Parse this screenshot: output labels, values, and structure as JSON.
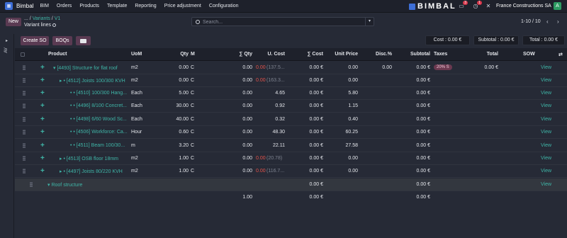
{
  "app": {
    "name": "Bimbal",
    "menu": [
      "BIM",
      "Orders",
      "Products",
      "Template",
      "Reporting",
      "Price adjustment",
      "Configuration"
    ],
    "brand": "BIMBAL",
    "chat_count": "3",
    "activity_count": "1",
    "company": "France Constructions SA",
    "user_initial": "A"
  },
  "control": {
    "new_label": "New",
    "breadcrumb": [
      "...",
      "Variants",
      "V1"
    ],
    "subtitle": "Variant lines",
    "search_placeholder": "Search...",
    "pager": "1-10 / 10"
  },
  "actions": {
    "create_so": "Create SO",
    "boqs": "BOQs"
  },
  "totals": {
    "cost": "Cost : 0.00 €",
    "subtotal": "Subtotal : 0.00 €",
    "total": "Total : 0.00 €"
  },
  "columns": {
    "product": "Product",
    "uom": "UoM",
    "qty": "Qty",
    "m": "M",
    "sum_qty": "∑ Qty",
    "unit_cost": "U. Cost",
    "sum_cost": "∑ Cost",
    "unit_price": "Unit Price",
    "disc": "Disc.%",
    "subtotal": "Subtotal",
    "taxes": "Taxes",
    "total": "Total",
    "sow": "SOW"
  },
  "rows": [
    {
      "product": "▾ [4493] Structure for flat roof",
      "uom": "m2",
      "qty": "0.00",
      "m": "C",
      "sum_qty": "0.00",
      "unit_cost": "0.00",
      "unit_cost_extra": "(137.5...",
      "sum_cost": "0.00 €",
      "unit_price": "0.00",
      "disc": "0.00",
      "subtotal": "0.00 €",
      "tax": "20% S",
      "total": "0.00 €",
      "sow": "View"
    },
    {
      "product": "▸ • [4512] Joists 100/300 KVH",
      "uom": "m2",
      "qty": "0.00",
      "m": "C",
      "sum_qty": "0.00",
      "unit_cost": "0.00",
      "unit_cost_extra": "(163.3...",
      "sum_cost": "0.00 €",
      "unit_price": "0.00",
      "disc": "",
      "subtotal": "0.00 €",
      "tax": "",
      "total": "",
      "sow": "View"
    },
    {
      "product": "• • [4510] 100/300 Hang...",
      "uom": "Each",
      "qty": "5.00",
      "m": "C",
      "sum_qty": "0.00",
      "unit_cost": "4.65",
      "unit_cost_extra": "",
      "sum_cost": "0.00 €",
      "unit_price": "5.80",
      "disc": "",
      "subtotal": "0.00 €",
      "tax": "",
      "total": "",
      "sow": "View"
    },
    {
      "product": "• • [4496] 8/100 Concret...",
      "uom": "Each",
      "qty": "30.00",
      "m": "C",
      "sum_qty": "0.00",
      "unit_cost": "0.92",
      "unit_cost_extra": "",
      "sum_cost": "0.00 €",
      "unit_price": "1.15",
      "disc": "",
      "subtotal": "0.00 €",
      "tax": "",
      "total": "",
      "sow": "View"
    },
    {
      "product": "• • [4498] 6/60 Wood Sc...",
      "uom": "Each",
      "qty": "40.00",
      "m": "C",
      "sum_qty": "0.00",
      "unit_cost": "0.32",
      "unit_cost_extra": "",
      "sum_cost": "0.00 €",
      "unit_price": "0.40",
      "disc": "",
      "subtotal": "0.00 €",
      "tax": "",
      "total": "",
      "sow": "View"
    },
    {
      "product": "• • [4506] Workforce: Ca...",
      "uom": "Hour",
      "qty": "0.60",
      "m": "C",
      "sum_qty": "0.00",
      "unit_cost": "48.30",
      "unit_cost_extra": "",
      "sum_cost": "0.00 €",
      "unit_price": "60.25",
      "disc": "",
      "subtotal": "0.00 €",
      "tax": "",
      "total": "",
      "sow": "View"
    },
    {
      "product": "• • [4511] Beam 100/30...",
      "uom": "m",
      "qty": "3.20",
      "m": "C",
      "sum_qty": "0.00",
      "unit_cost": "22.11",
      "unit_cost_extra": "",
      "sum_cost": "0.00 €",
      "unit_price": "27.58",
      "disc": "",
      "subtotal": "0.00 €",
      "tax": "",
      "total": "",
      "sow": "View"
    },
    {
      "product": "▸ • [4513] OSB floor 18mm",
      "uom": "m2",
      "qty": "1.00",
      "m": "C",
      "sum_qty": "0.00",
      "unit_cost": "0.00",
      "unit_cost_extra": "(20.78)",
      "sum_cost": "0.00 €",
      "unit_price": "0.00",
      "disc": "",
      "subtotal": "0.00 €",
      "tax": "",
      "total": "",
      "sow": "View"
    },
    {
      "product": "▸ • [4497] Joists 80/220 KVH",
      "uom": "m2",
      "qty": "1.00",
      "m": "C",
      "sum_qty": "0.00",
      "unit_cost": "0.00",
      "unit_cost_extra": "(116.7...",
      "sum_cost": "0.00 €",
      "unit_price": "0.00",
      "disc": "",
      "subtotal": "0.00 €",
      "tax": "",
      "total": "",
      "sow": "View"
    }
  ],
  "section": {
    "label": "▾ Roof structure",
    "sum_cost": "0.00 €",
    "subtotal": "0.00 €",
    "sow": "View"
  },
  "footer": {
    "qty_total": "1.00",
    "cost_total": "0.00 €",
    "subtotal_total": "0.00 €"
  }
}
